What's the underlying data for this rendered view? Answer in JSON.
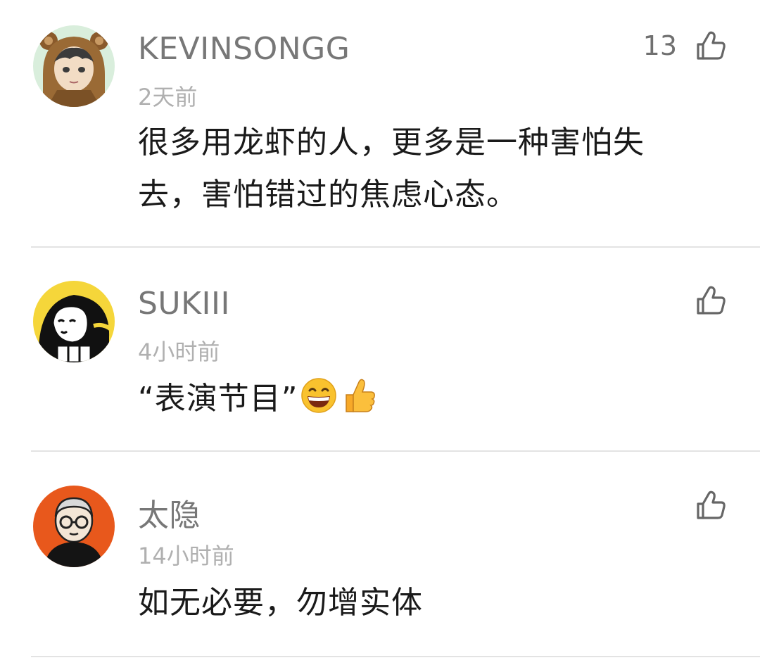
{
  "comments": [
    {
      "username": "KEVINSONGG",
      "time": "2天前",
      "text": "很多用龙虾的人，更多是一种害怕失去，害怕错过的焦虑心态。",
      "likes": "13",
      "avatar_icon": "bear-hood-boy-avatar",
      "avatar_bg": "#d7ecd9"
    },
    {
      "username": "SUKIII",
      "time": "4小时前",
      "text": "“表演节目”",
      "emojis": [
        "grinning-face-emoji",
        "thumbs-up-emoji"
      ],
      "likes": "",
      "avatar_icon": "cartoon-girl-avatar",
      "avatar_bg": "#f5d63a"
    },
    {
      "username": "太隐",
      "time": "14小时前",
      "text": "如无必要，勿增实体",
      "likes": "",
      "avatar_icon": "glasses-man-avatar",
      "avatar_bg": "#e8581c"
    }
  ],
  "colors": {
    "username": "#777777",
    "timestamp": "#b0b0b0",
    "body": "#1a1a1a",
    "like_icon": "#666666",
    "divider": "#e3e3e3"
  }
}
